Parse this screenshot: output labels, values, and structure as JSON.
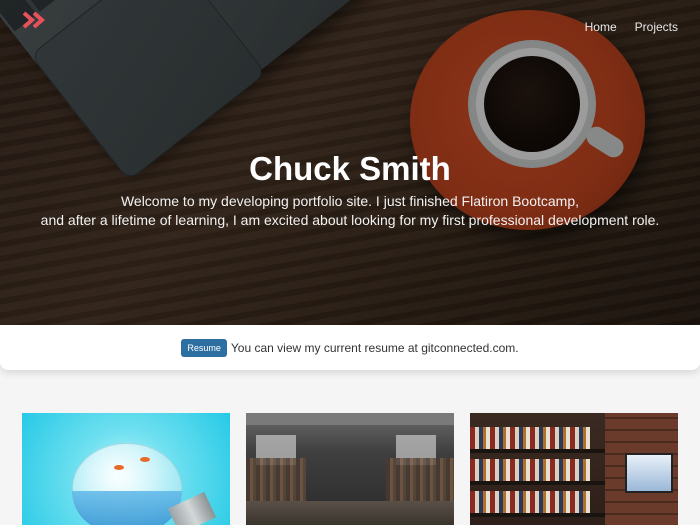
{
  "nav": {
    "logo_icon": "double-chevron-right-icon",
    "logo_color": "#e8505b",
    "items": [
      {
        "label": "Home"
      },
      {
        "label": "Projects"
      }
    ]
  },
  "hero": {
    "title": "Chuck Smith",
    "subtitle_line1": "Welcome to my developing portfolio site. I just finished Flatiron Bootcamp,",
    "subtitle_line2": "and after a lifetime of learning, I am excited about looking for my first professional development role."
  },
  "resume": {
    "button_label": "Resume",
    "text": "You can view my current resume at gitconnected.com.",
    "button_color": "#2d6fa0"
  },
  "cards": [
    {
      "image": "lightbulb-with-fish-image"
    },
    {
      "image": "workshop-image"
    },
    {
      "image": "bookshelf-image"
    }
  ]
}
